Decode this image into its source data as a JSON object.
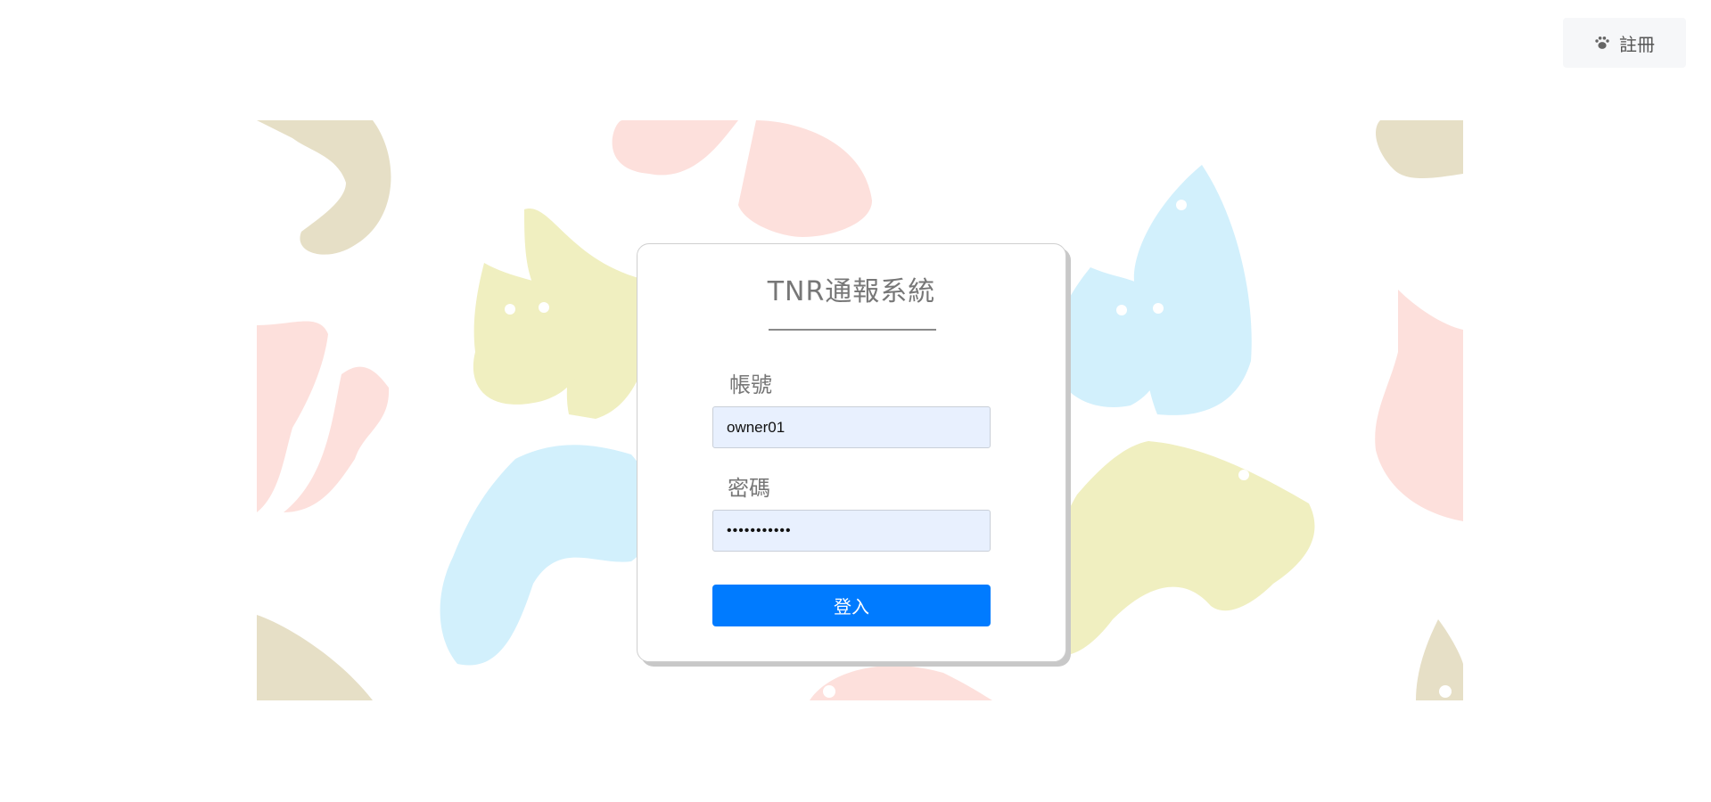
{
  "header": {
    "register_label": "註冊",
    "register_icon": "paw-icon"
  },
  "login": {
    "title": "TNR通報系統",
    "account_label": "帳號",
    "account_value": "owner01",
    "password_label": "密碼",
    "password_value": "•••••••••••",
    "submit_label": "登入"
  },
  "colors": {
    "primary": "#007bff",
    "input_bg": "#e8f0fe",
    "pattern_tan": "#e6dfc6",
    "pattern_pink": "#fde0dc",
    "pattern_yellow": "#f0efc0",
    "pattern_blue": "#d2f0fc"
  }
}
